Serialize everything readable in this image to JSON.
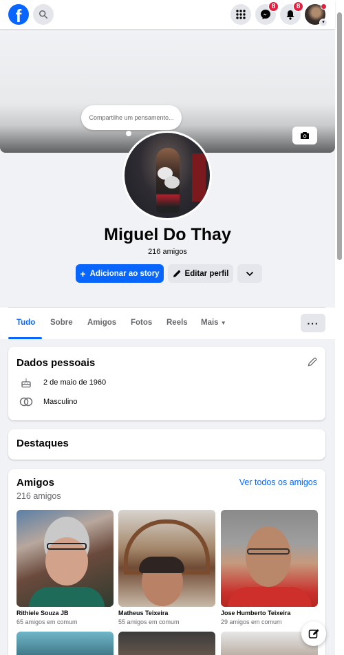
{
  "topbar": {
    "messenger_badge": "8",
    "notifications_badge": "8"
  },
  "cover": {
    "thought_placeholder": "Compartilhe um pensamento..."
  },
  "profile": {
    "name": "Miguel Do Thay",
    "friends_count": "216 amigos",
    "add_story_label": "Adicionar ao story",
    "edit_profile_label": "Editar perfil"
  },
  "tabs": [
    {
      "label": "Tudo",
      "active": true
    },
    {
      "label": "Sobre"
    },
    {
      "label": "Amigos"
    },
    {
      "label": "Fotos"
    },
    {
      "label": "Reels"
    },
    {
      "label": "Mais"
    }
  ],
  "personal": {
    "title": "Dados pessoais",
    "birthday": "2 de maio de 1960",
    "gender": "Masculino"
  },
  "highlights": {
    "title": "Destaques"
  },
  "friends": {
    "title": "Amigos",
    "see_all": "Ver todos os amigos",
    "count": "216 amigos",
    "items": [
      {
        "name": "Rithiele Souza JB",
        "mutual": "65 amigos em comum"
      },
      {
        "name": "Matheus Teixeira",
        "mutual": "55 amigos em comum"
      },
      {
        "name": "Jose Humberto Teixeira",
        "mutual": "29 amigos em comum"
      }
    ]
  },
  "colors": {
    "accent": "#0866ff",
    "badge": "#e41e3f",
    "background": "#f0f2f5"
  }
}
